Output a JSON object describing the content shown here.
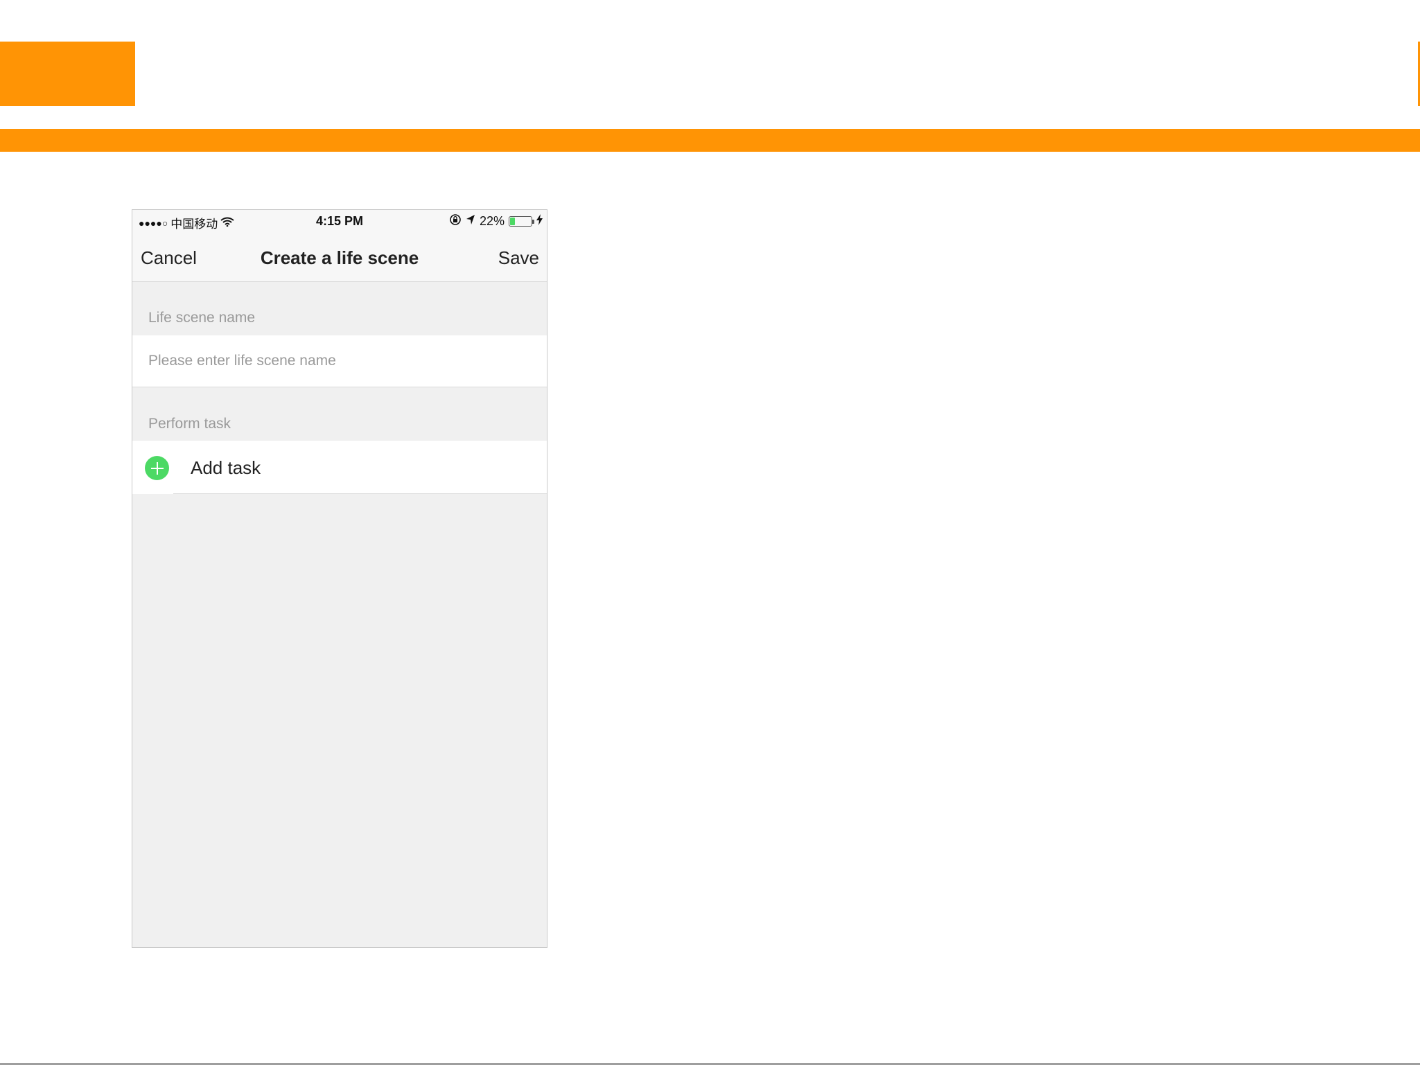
{
  "status_bar": {
    "signal": "●●●●○",
    "carrier": "中国移动",
    "time": "4:15 PM",
    "battery_percent": "22%",
    "battery_level": 0.22
  },
  "nav": {
    "cancel_label": "Cancel",
    "title": "Create a life scene",
    "save_label": "Save"
  },
  "form": {
    "name_section_label": "Life scene name",
    "name_placeholder": "Please enter life scene name",
    "name_value": "",
    "task_section_label": "Perform task",
    "add_task_label": "Add task"
  },
  "colors": {
    "accent": "#ff9405",
    "add_button": "#4cd964",
    "background": "#f0f0f0"
  }
}
